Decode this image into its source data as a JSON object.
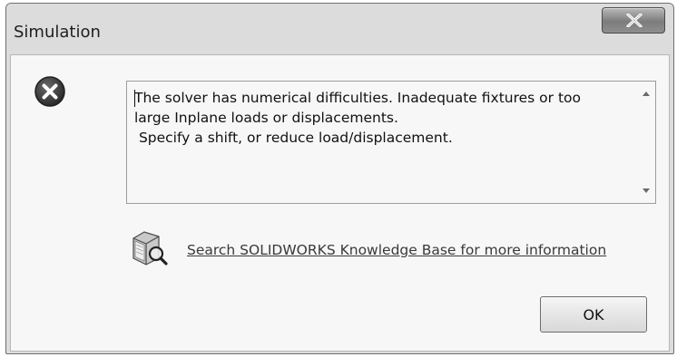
{
  "window": {
    "title": "Simulation",
    "close_icon": "close-x-icon"
  },
  "dialog": {
    "status_icon": "error-circle-x-icon",
    "message": "The solver has numerical difficulties. Inadequate fixtures or too\nlarge Inplane loads or displacements.\n Specify a shift, or reduce load/displacement.",
    "scroll_up_icon": "scroll-up-arrow-icon",
    "scroll_down_icon": "scroll-down-arrow-icon",
    "knowledge_base": {
      "icon": "book-magnifier-icon",
      "link_text": "Search SOLIDWORKS Knowledge Base for more information"
    },
    "ok_label": "OK"
  }
}
